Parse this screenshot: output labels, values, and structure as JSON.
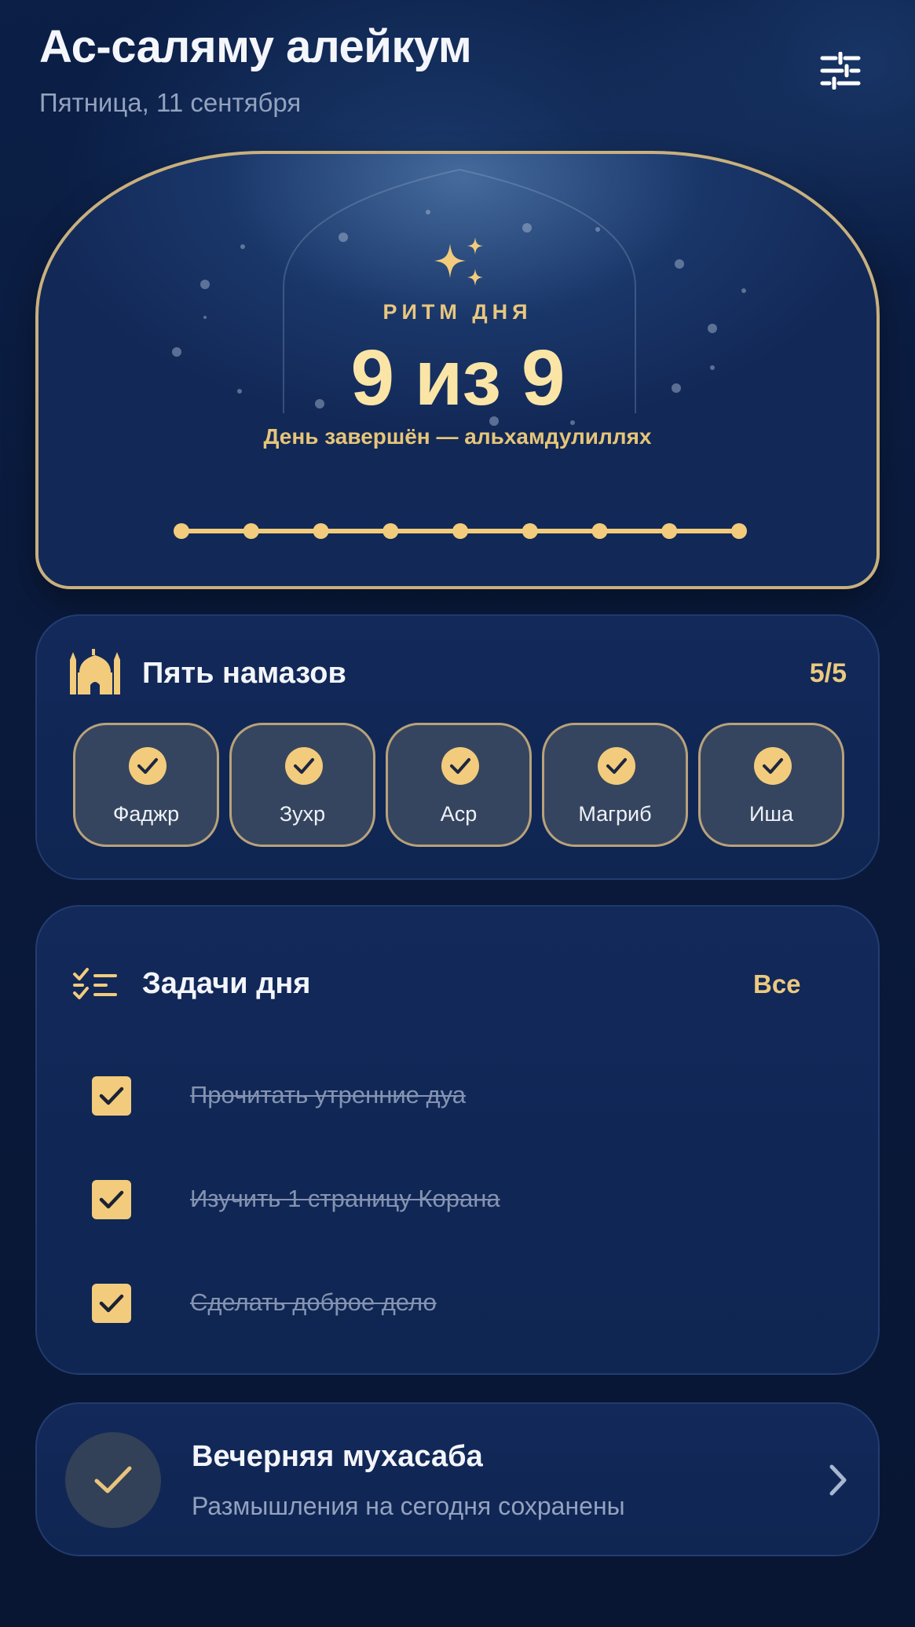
{
  "header": {
    "greeting": "Ас-саляму алейкум",
    "date": "Пятница, 11 сентября"
  },
  "hero": {
    "label": "РИТМ ДНЯ",
    "value": "9 из 9",
    "subtitle": "День завершён — альхамдулиллях",
    "progress_done": 9,
    "progress_total": 9
  },
  "prayers": {
    "title": "Пять намазов",
    "count": "5/5",
    "items": [
      {
        "name": "Фаджр",
        "done": true
      },
      {
        "name": "Зухр",
        "done": true
      },
      {
        "name": "Аср",
        "done": true
      },
      {
        "name": "Магриб",
        "done": true
      },
      {
        "name": "Иша",
        "done": true
      }
    ]
  },
  "tasks": {
    "title": "Задачи дня",
    "all_label": "Все",
    "items": [
      {
        "text": "Прочитать утренние дуа",
        "done": true
      },
      {
        "text": "Изучить 1 страницу Корана",
        "done": true
      },
      {
        "text": "Сделать доброе дело",
        "done": true
      }
    ]
  },
  "evening": {
    "title": "Вечерняя мухасаба",
    "subtitle": "Размышления на сегодня сохранены"
  },
  "colors": {
    "accent_gold": "#f2cc7c",
    "gold_text": "#ebc97f",
    "card_bg": "#12295a",
    "muted_text": "#93a2bf"
  },
  "icons": {
    "settings": "sliders-icon",
    "hero": "sparkles-icon",
    "prayers": "mosque-icon",
    "tasks": "checklist-icon",
    "evening": "check-icon",
    "chevron": "chevron-right-icon"
  }
}
